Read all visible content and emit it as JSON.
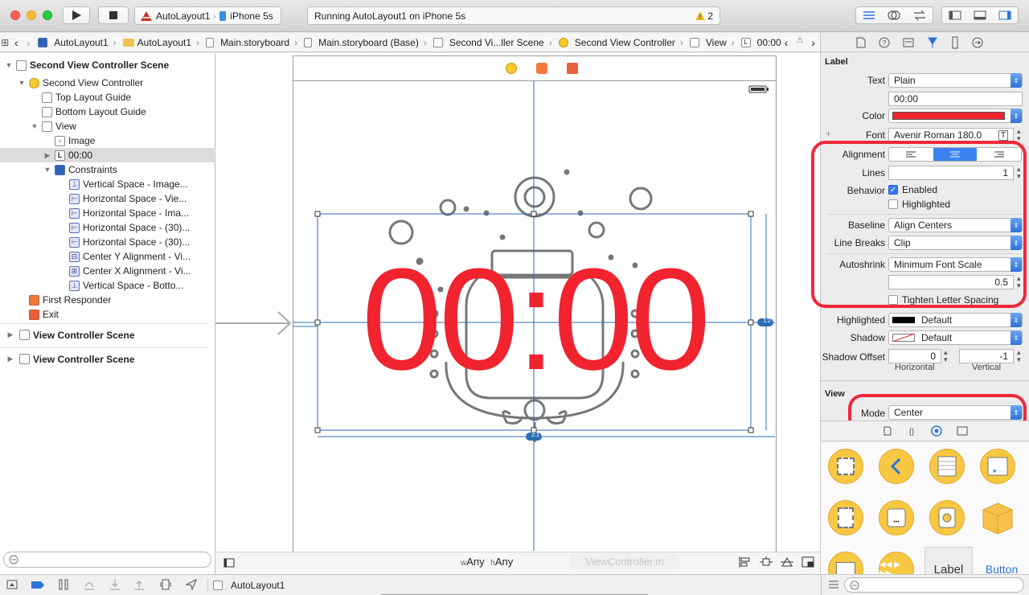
{
  "toolbar": {
    "scheme_name": "AutoLayout1",
    "device": "iPhone 5s",
    "activity_text": "Running AutoLayout1 on iPhone 5s",
    "warning_count": "2"
  },
  "jumpbar": {
    "crumbs": [
      "AutoLayout1",
      "AutoLayout1",
      "Main.storyboard",
      "Main.storyboard (Base)",
      "Second Vi...ller Scene",
      "Second View Controller",
      "View",
      "00:00"
    ]
  },
  "outline": {
    "scene_title": "Second View Controller Scene",
    "controller": "Second View Controller",
    "top_guide": "Top Layout Guide",
    "bottom_guide": "Bottom Layout Guide",
    "view": "View",
    "image": "Image",
    "label": "00:00",
    "constraints": "Constraints",
    "constraint_items": [
      "Vertical Space - Image...",
      "Horizontal Space - Vie...",
      "Horizontal Space - Ima...",
      "Horizontal Space - (30)...",
      "Horizontal Space - (30)...",
      "Center Y Alignment - Vi...",
      "Center X Alignment - Vi...",
      "Vertical Space - Botto..."
    ],
    "first_responder": "First Responder",
    "exit": "Exit",
    "other_scenes": [
      "View Controller Scene",
      "View Controller Scene"
    ]
  },
  "canvas": {
    "label_text": "00:00",
    "size_class_w": "Any",
    "size_class_h": "Any",
    "badge_ratio": "1:2",
    "badge_bottom": "2:1",
    "tooltip": "ViewController.m",
    "label_color": "#f0232f"
  },
  "inspector": {
    "section_label": "Label",
    "text_label": "Text",
    "text_mode": "Plain",
    "text_value": "00:00",
    "color_label": "Color",
    "font_label": "Font",
    "font_value": "Avenir Roman 180.0",
    "alignment_label": "Alignment",
    "lines_label": "Lines",
    "lines_value": "1",
    "behavior_label": "Behavior",
    "enabled_label": "Enabled",
    "highlighted_chk_label": "Highlighted",
    "baseline_label": "Baseline",
    "baseline_value": "Align Centers",
    "linebreaks_label": "Line Breaks",
    "linebreaks_value": "Clip",
    "autoshrink_label": "Autoshrink",
    "autoshrink_value": "Minimum Font Scale",
    "scale_value": "0.5",
    "tighten_label": "Tighten Letter Spacing",
    "highlighted_label": "Highlighted",
    "highlighted_value": "Default",
    "shadow_label": "Shadow",
    "shadow_value": "Default",
    "shadow_offset_label": "Shadow Offset",
    "offset_h": "0",
    "offset_v": "-1",
    "horizontal_label": "Horizontal",
    "vertical_label": "Vertical",
    "view_section": "View",
    "mode_label": "Mode",
    "mode_value": "Center",
    "library_label_item": "Label",
    "library_button_item": "Button"
  },
  "debug": {
    "target": "AutoLayout1"
  },
  "colors": {
    "accent": "#2d72d9",
    "highlight_ring": "#f0283a",
    "library_icon": "#f8c843"
  }
}
